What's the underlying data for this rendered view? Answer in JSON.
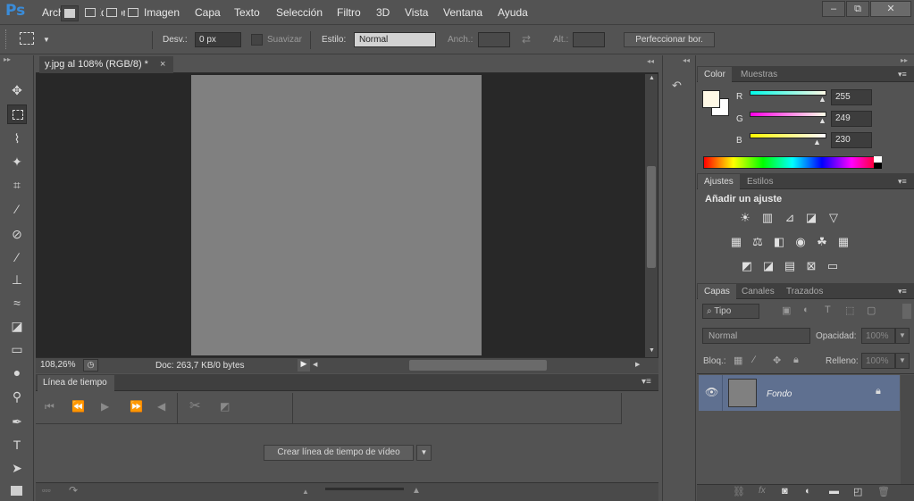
{
  "app": {
    "logo": "Ps"
  },
  "menu": [
    "Archivo",
    "Edición",
    "Imagen",
    "Capa",
    "Texto",
    "Selección",
    "Filtro",
    "3D",
    "Vista",
    "Ventana",
    "Ayuda"
  ],
  "window_controls": {
    "minimize": "–",
    "restore": "⧉",
    "close": "✕"
  },
  "options": {
    "feather_label": "Desv.:",
    "feather_value": "0 px",
    "antialias_label": "Suavizar",
    "style_label": "Estilo:",
    "style_value": "Normal",
    "width_label": "Anch.:",
    "height_label": "Alt.:",
    "refine_button": "Perfeccionar bor."
  },
  "document": {
    "tab_title": "y.jpg al 108% (RGB/8) *",
    "close": "×",
    "zoom": "108,26%",
    "doc_info": "Doc: 263,7 KB/0 bytes",
    "canvas_color": "#808080"
  },
  "timeline": {
    "tab": "Línea de tiempo",
    "create_button": "Crear línea de tiempo de vídeo"
  },
  "color_panel": {
    "tabs": [
      "Color",
      "Muestras"
    ],
    "channels": [
      {
        "label": "R",
        "value": "255"
      },
      {
        "label": "G",
        "value": "249"
      },
      {
        "label": "B",
        "value": "230"
      }
    ],
    "foreground": "#fff9e6",
    "background": "#ffffff"
  },
  "adjust_panel": {
    "tabs": [
      "Ajustes",
      "Estilos"
    ],
    "heading": "Añadir un ajuste"
  },
  "layers_panel": {
    "tabs": [
      "Capas",
      "Canales",
      "Trazados"
    ],
    "filter": "Tipo",
    "blend": "Normal",
    "opacity_label": "Opacidad:",
    "opacity_value": "100%",
    "lock_label": "Bloq.:",
    "fill_label": "Relleno:",
    "fill_value": "100%",
    "layers": [
      {
        "name": "Fondo"
      }
    ]
  }
}
